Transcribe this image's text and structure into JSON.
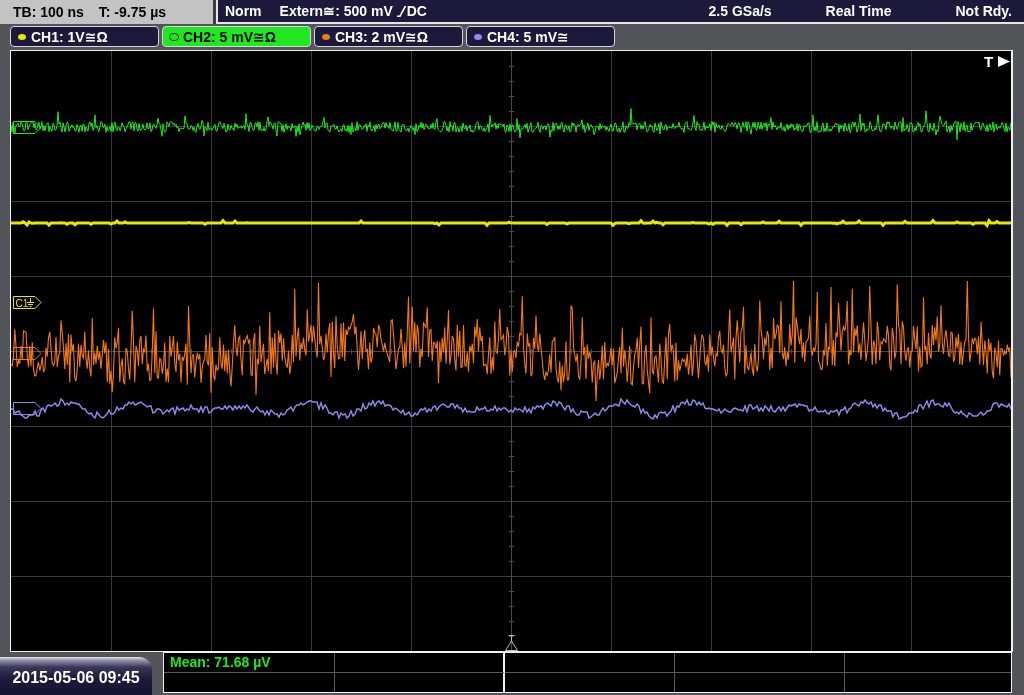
{
  "status_bar": {
    "timebase": "TB: 100 ns",
    "trigger_time": "T: -9.75 µs",
    "trigger_mode": "Norm",
    "trigger_source": "Extern≅: 500 mV",
    "coupling": "DC",
    "sample_rate": "2.5 GSa/s",
    "acquisition": "Real Time",
    "state": "Not Rdy."
  },
  "channels": [
    {
      "label": "CH1: 1V≅Ω",
      "color": "#e8e800",
      "selected": false
    },
    {
      "label": "CH2: 5 mV≅Ω",
      "color": "#20e820",
      "selected": true
    },
    {
      "label": "CH3: 2 mV≅Ω",
      "color": "#f07820",
      "selected": false
    },
    {
      "label": "CH4: 5 mV≅",
      "color": "#8c8cf0",
      "selected": false
    }
  ],
  "screen": {
    "channel_marker": {
      "label": "C1"
    },
    "trigger_marker": {
      "label": "T"
    }
  },
  "date_time": "2015-05-06 09:45",
  "measurements": [
    {
      "text": "Mean: 71.68 µV"
    }
  ]
}
